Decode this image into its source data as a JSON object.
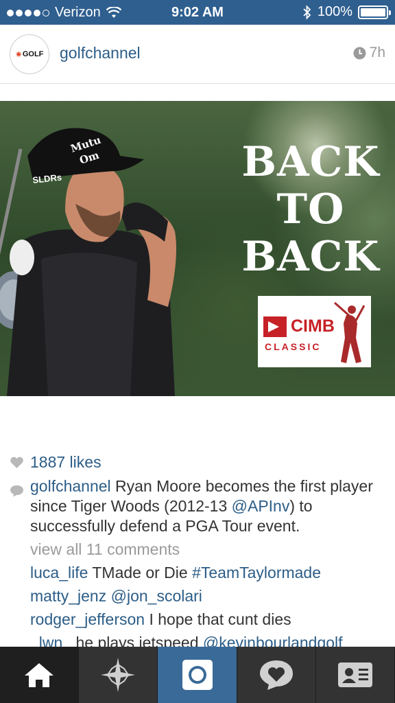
{
  "status_bar": {
    "carrier": "Verizon",
    "time": "9:02 AM",
    "battery": "100%",
    "battery_level": 1.0,
    "signal_bars": 4
  },
  "post": {
    "username": "golfchannel",
    "avatar_text": "GOLF",
    "age": "7h",
    "photo": {
      "headline": [
        "BACK",
        "TO",
        "BACK"
      ],
      "cap_text": "Mutual of Omaha",
      "hat_brand": "SLDR",
      "sponsor_name": "CIMB",
      "sponsor_sub": "CLASSIC"
    },
    "likes": "1887 likes",
    "caption": {
      "user": "golfchannel",
      "text_before": " Ryan Moore becomes the first player since Tiger Woods (2012-13 ",
      "mention": "@APInv",
      "text_after": ") to successfully defend a PGA Tour event."
    },
    "view_all": "view all 11 comments",
    "comments": [
      {
        "user": "luca_life",
        "text": " TMade or Die ",
        "link": "#TeamTaylormade"
      },
      {
        "user": "matty_jenz",
        "text": " ",
        "link": "@jon_scolari"
      },
      {
        "user": "rodger_jefferson",
        "text": " I hope that cunt dies",
        "link": ""
      },
      {
        "user": "_lwn_",
        "text": " he plays jetspeed ",
        "link": "@kevinbourlandgolf"
      }
    ]
  },
  "tab_bar": {
    "tabs": [
      "home",
      "explore",
      "camera",
      "activity",
      "profile"
    ],
    "selected": "camera",
    "colors": {
      "selected": "#3a6a97",
      "bar": "#2a2a2a"
    }
  },
  "colors": {
    "accent": "#2c5d87",
    "status_bar": "#2f5f8f",
    "sponsor_red": "#c62127"
  }
}
